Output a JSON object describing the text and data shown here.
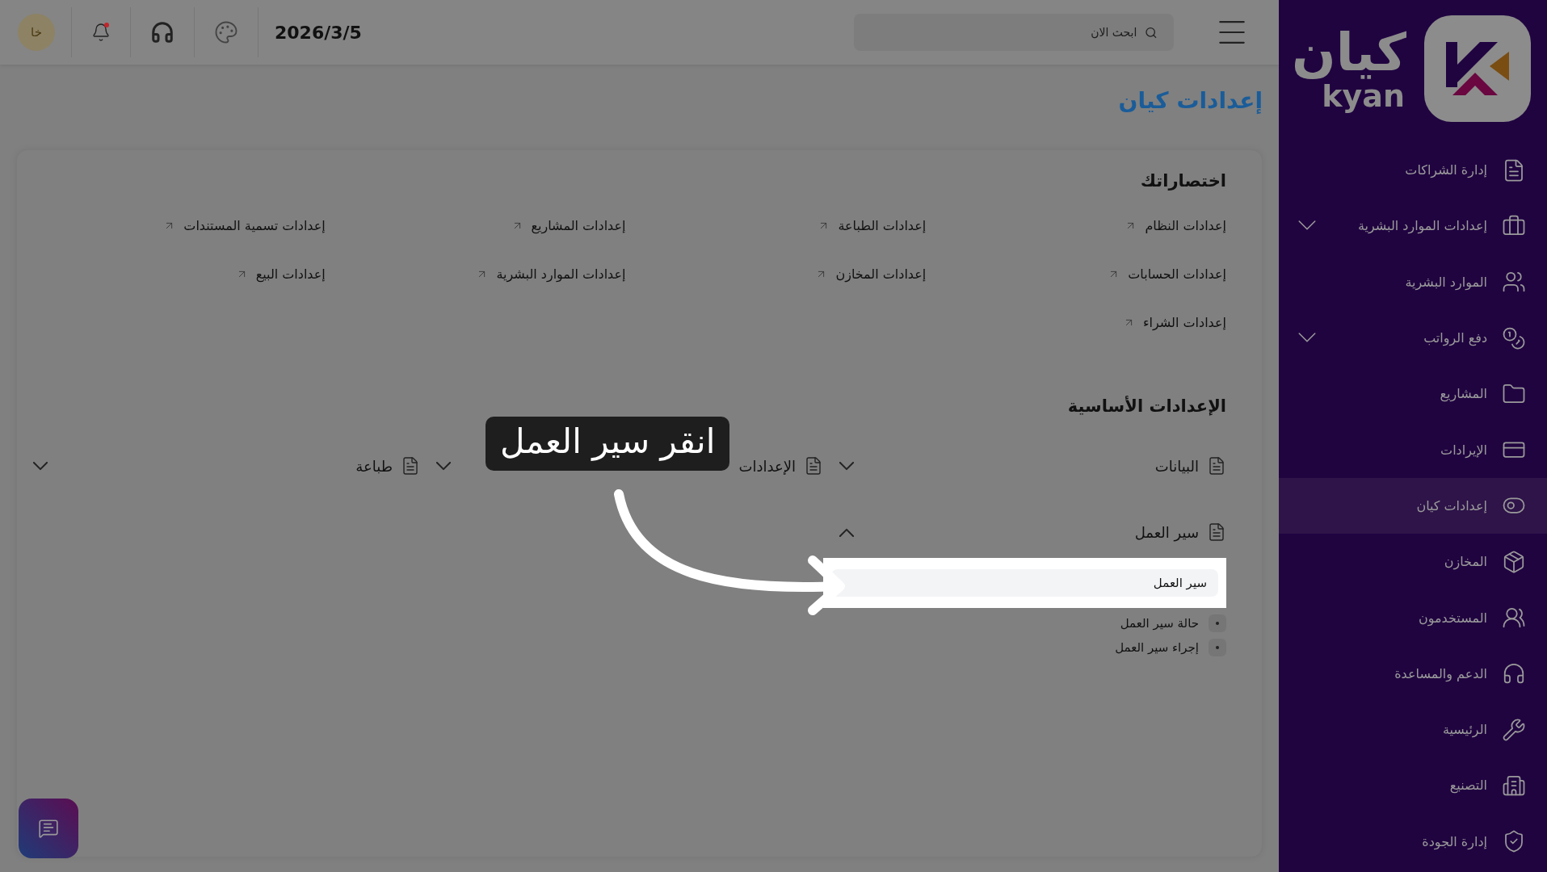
{
  "sidebar": {
    "logo": {
      "text_ar": "كيان",
      "text_en": "kyan"
    },
    "items": [
      {
        "label": "إدارة الشراكات",
        "has_submenu": false,
        "selected": false
      },
      {
        "label": "إعدادات الموارد البشرية",
        "has_submenu": true,
        "selected": false
      },
      {
        "label": "الموارد البشرية",
        "has_submenu": false,
        "selected": false
      },
      {
        "label": "دفع الرواتب",
        "has_submenu": true,
        "selected": false
      },
      {
        "label": "المشاريع",
        "has_submenu": false,
        "selected": false
      },
      {
        "label": "الإيرادات",
        "has_submenu": false,
        "selected": false
      },
      {
        "label": "إعدادات كيان",
        "has_submenu": false,
        "selected": true
      },
      {
        "label": "المخازن",
        "has_submenu": false,
        "selected": false
      },
      {
        "label": "المستخدمون",
        "has_submenu": false,
        "selected": false
      },
      {
        "label": "الدعم والمساعدة",
        "has_submenu": false,
        "selected": false
      },
      {
        "label": "الرئيسية",
        "has_submenu": false,
        "selected": false
      },
      {
        "label": "التصنيع",
        "has_submenu": false,
        "selected": false
      },
      {
        "label": "إدارة الجودة",
        "has_submenu": false,
        "selected": false
      }
    ]
  },
  "topbar": {
    "search": {
      "placeholder": "ابحث الان"
    },
    "date": "2026/3/5",
    "avatar": "خا",
    "notification_dot": true
  },
  "page": {
    "title": "إعدادات كيان"
  },
  "shortcuts": {
    "title": "اختصاراتك",
    "items": [
      "إعدادات النظام",
      "إعدادات الطباعة",
      "إعدادات المشاريع",
      "إعدادات تسمية المستندات",
      "إعدادات الحسابات",
      "إعدادات المخازن",
      "إعدادات الموارد البشرية",
      "إعدادات البيع",
      "إعدادات الشراء"
    ]
  },
  "basic_settings": {
    "title": "الإعدادات الأساسية",
    "groups": [
      {
        "label": "البيانات",
        "expanded": false
      },
      {
        "label": "الإعدادات",
        "expanded": false
      },
      {
        "label": "طباعة",
        "expanded": false
      },
      {
        "label": "سير العمل",
        "expanded": true,
        "children": [
          {
            "label": "سير العمل",
            "selected": true
          },
          {
            "label": "حالة سير العمل",
            "selected": false
          },
          {
            "label": "إجراء سير العمل",
            "selected": false
          }
        ]
      }
    ]
  },
  "tour_tip": {
    "text": "انقر سير العمل"
  }
}
